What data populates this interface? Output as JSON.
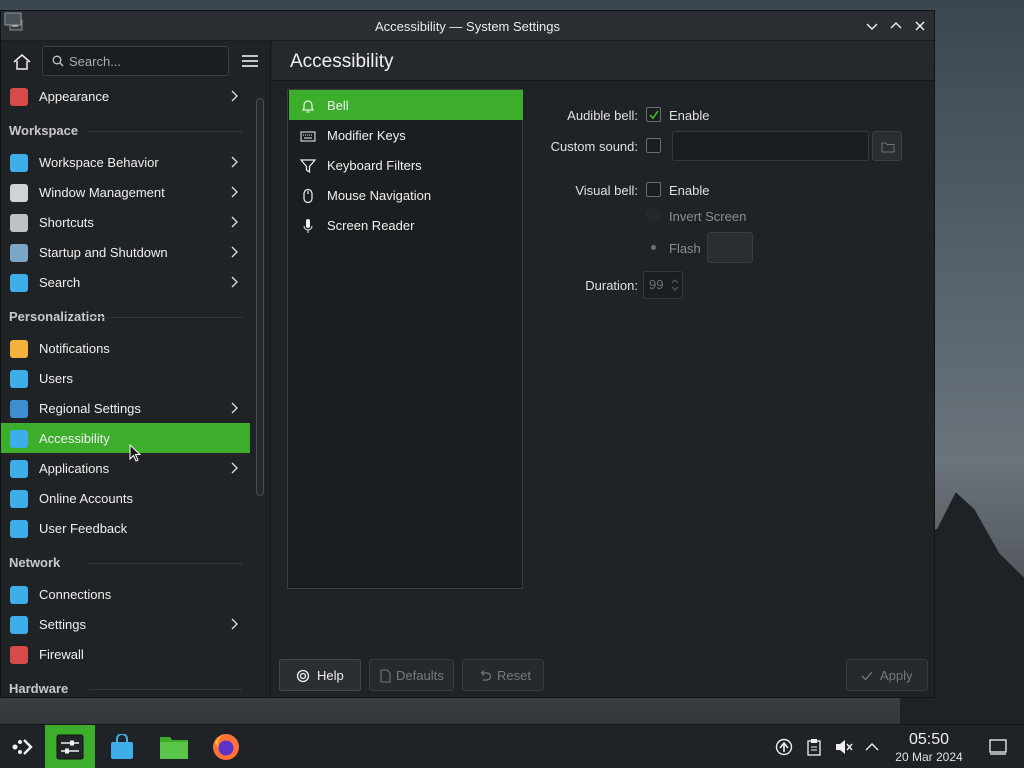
{
  "window": {
    "title": "Accessibility — System Settings"
  },
  "sidebar": {
    "search_placeholder": "Search...",
    "items": [
      {
        "label": "Appearance",
        "icon": "appearance-icon",
        "color": "#d64a4a",
        "chevron": true
      },
      {
        "section": "Workspace"
      },
      {
        "label": "Workspace Behavior",
        "icon": "workspace-behavior-icon",
        "color": "#3daee9",
        "chevron": true
      },
      {
        "label": "Window Management",
        "icon": "window-management-icon",
        "color": "#d0d3d6",
        "chevron": true
      },
      {
        "label": "Shortcuts",
        "icon": "shortcuts-icon",
        "color": "#bfc2c5",
        "chevron": true
      },
      {
        "label": "Startup and Shutdown",
        "icon": "startup-shutdown-icon",
        "color": "#7aa7c7",
        "chevron": true
      },
      {
        "label": "Search",
        "icon": "search-icon",
        "color": "#3daee9",
        "chevron": true
      },
      {
        "section": "Personalization"
      },
      {
        "label": "Notifications",
        "icon": "notifications-icon",
        "color": "#f3b23b",
        "chevron": false
      },
      {
        "label": "Users",
        "icon": "users-icon",
        "color": "#3daee9",
        "chevron": false
      },
      {
        "label": "Regional Settings",
        "icon": "regional-settings-icon",
        "color": "#3d8fd1",
        "chevron": true
      },
      {
        "label": "Accessibility",
        "icon": "accessibility-icon",
        "color": "#3daee9",
        "chevron": false,
        "selected": true
      },
      {
        "label": "Applications",
        "icon": "applications-icon",
        "color": "#3daee9",
        "chevron": true
      },
      {
        "label": "Online Accounts",
        "icon": "online-accounts-icon",
        "color": "#3daee9",
        "chevron": false
      },
      {
        "label": "User Feedback",
        "icon": "user-feedback-icon",
        "color": "#3daee9",
        "chevron": false
      },
      {
        "section": "Network"
      },
      {
        "label": "Connections",
        "icon": "connections-icon",
        "color": "#3daee9",
        "chevron": false
      },
      {
        "label": "Settings",
        "icon": "network-settings-icon",
        "color": "#3daee9",
        "chevron": true
      },
      {
        "label": "Firewall",
        "icon": "firewall-icon",
        "color": "#d64a4a",
        "chevron": false
      },
      {
        "section": "Hardware"
      }
    ]
  },
  "content": {
    "title": "Accessibility",
    "list": [
      {
        "label": "Bell",
        "icon": "bell-icon",
        "selected": true
      },
      {
        "label": "Modifier Keys",
        "icon": "keyboard-icon"
      },
      {
        "label": "Keyboard Filters",
        "icon": "filter-icon"
      },
      {
        "label": "Mouse Navigation",
        "icon": "mouse-icon"
      },
      {
        "label": "Screen Reader",
        "icon": "microphone-icon"
      }
    ],
    "form": {
      "audible_bell_label": "Audible bell:",
      "audible_enable": "Enable",
      "custom_sound_label": "Custom sound:",
      "custom_sound_value": "",
      "visual_bell_label": "Visual bell:",
      "visual_enable": "Enable",
      "invert_screen": "Invert Screen",
      "flash": "Flash",
      "duration_label": "Duration:",
      "duration_value": "99"
    },
    "buttons": {
      "help": "Help",
      "defaults": "Defaults",
      "reset": "Reset",
      "apply": "Apply"
    }
  },
  "taskbar": {
    "time": "05:50",
    "date": "20 Mar 2024"
  },
  "colors": {
    "accent": "#3dae2b"
  }
}
